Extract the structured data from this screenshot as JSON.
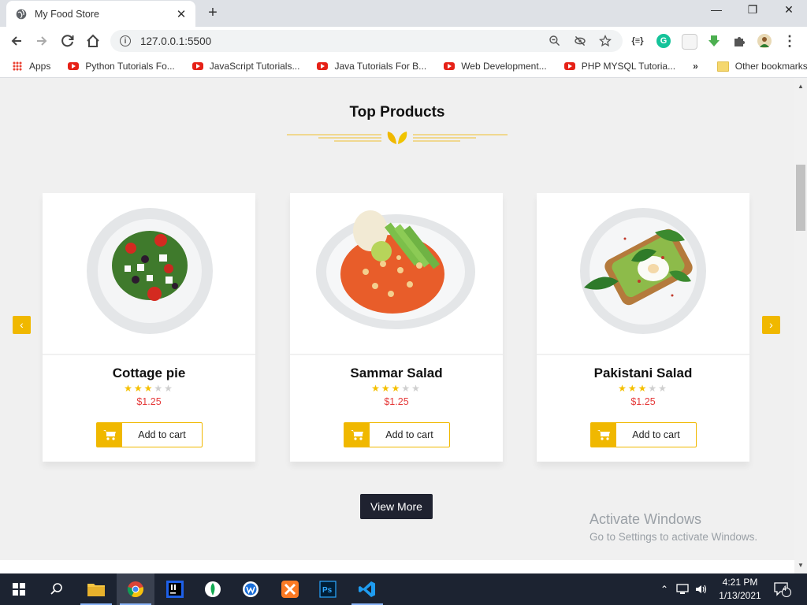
{
  "browser": {
    "tab_title": "My Food Store",
    "tab_close": "✕",
    "new_tab": "+",
    "url": "127.0.0.1:5500",
    "window_controls": {
      "minimize": "—",
      "restore": "❐",
      "close": "✕"
    }
  },
  "bookmarks": {
    "apps": "Apps",
    "items": [
      "Python Tutorials Fo...",
      "JavaScript Tutorials...",
      "Java Tutorials For B...",
      "Web Development...",
      "PHP MYSQL Tutoria..."
    ],
    "more": "»",
    "other": "Other bookmarks"
  },
  "page": {
    "section_title": "Top Products",
    "products": [
      {
        "name": "Cottage pie",
        "rating": 3,
        "max_rating": 5,
        "price": "$1.25",
        "button": "Add to cart"
      },
      {
        "name": "Sammar Salad",
        "rating": 3,
        "max_rating": 5,
        "price": "$1.25",
        "button": "Add to cart"
      },
      {
        "name": "Pakistani Salad",
        "rating": 3,
        "max_rating": 5,
        "price": "$1.25",
        "button": "Add to cart"
      }
    ],
    "prev_arrow": "‹",
    "next_arrow": "›",
    "view_more": "View More",
    "accent_color": "#f0b800",
    "price_color": "#e53b3b"
  },
  "watermark": {
    "line1": "Activate Windows",
    "line2": "Go to Settings to activate Windows."
  },
  "taskbar": {
    "time": "4:21 PM",
    "date": "1/13/2021",
    "notifications": "4"
  }
}
